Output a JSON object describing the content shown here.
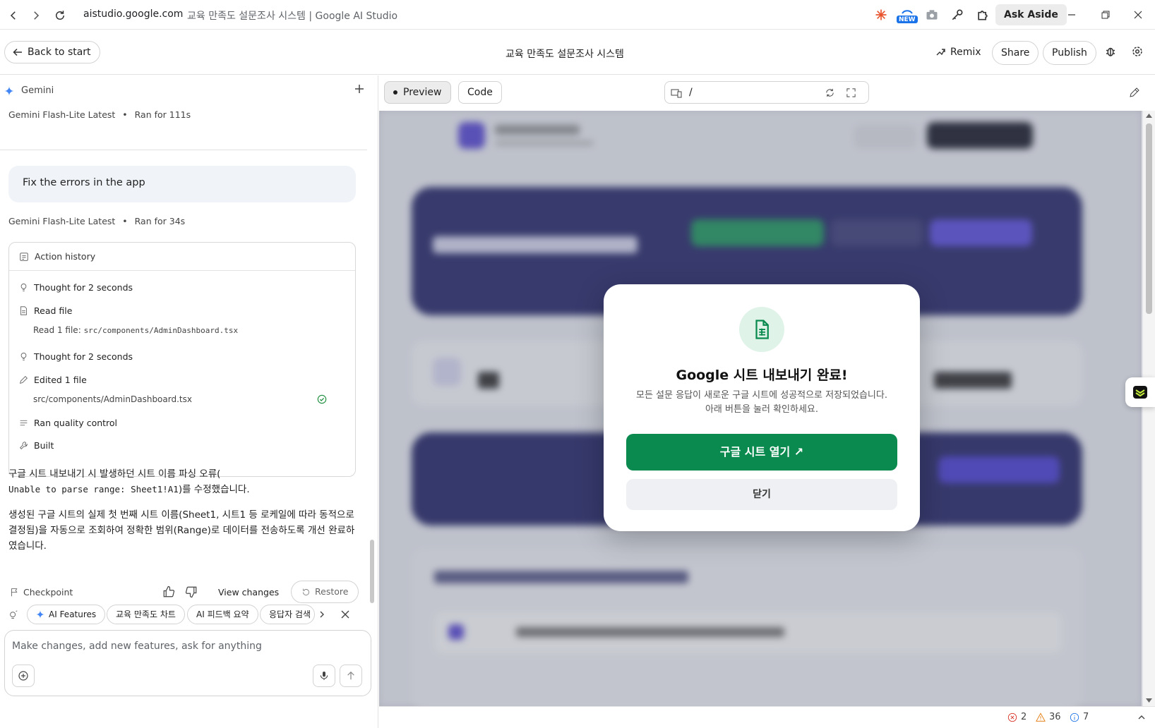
{
  "browser": {
    "url": "aistudio.google.com",
    "page_title": "교육 만족도 설문조사 시스템 | Google AI Studio",
    "new_badge": "NEW",
    "ask_aside": "Ask Aside"
  },
  "header": {
    "back_label": "Back to start",
    "title": "교육 만족도 설문조사 시스템",
    "remix": "Remix",
    "share": "Share",
    "publish": "Publish"
  },
  "chat": {
    "gemini_label": "Gemini",
    "meta1_model": "Gemini Flash-Lite Latest",
    "meta1_run": "Ran for 111s",
    "user_message": "Fix the errors in the app",
    "meta2_model": "Gemini Flash-Lite Latest",
    "meta2_run": "Ran for 34s",
    "action_history_title": "Action history",
    "actions": {
      "thought1": "Thought for 2 seconds",
      "read_file": "Read file",
      "read_sub_label": "Read 1 file:",
      "read_sub_path": "src/components/AdminDashboard.tsx",
      "thought2": "Thought for 2 seconds",
      "edited": "Edited 1 file",
      "edited_path": "src/components/AdminDashboard.tsx",
      "quality": "Ran quality control",
      "built": "Built"
    },
    "response_p1_a": "구글 시트 내보내기 시 발생하던 시트 이름 파싱 오류(",
    "response_p1_code": "Unable to parse range: Sheet1!A1",
    "response_p1_b": ")를 수정했습니다.",
    "response_p2": "생성된 구글 시트의 실제 첫 번째 시트 이름(Sheet1, 시트1 등 로케일에 따라 동적으로 결정됨)을 자동으로 조회하여 정확한 범위(Range)로 데이터를 전송하도록 개선 완료하였습니다.",
    "checkpoint": "Checkpoint",
    "view_changes": "View changes",
    "restore": "Restore",
    "chips": [
      "AI Features",
      "교육 만족도 차트",
      "AI 피드백 요약",
      "응답자 검색"
    ],
    "composer_placeholder": "Make changes, add new features, ask for anything"
  },
  "preview": {
    "tab_preview": "Preview",
    "tab_code": "Code",
    "url_path": "/",
    "modal": {
      "title": "Google 시트 내보내기 완료!",
      "desc_line1": "모든 설문 응답이 새로운 구글 시트에 성공적으로 저장되었습니다.",
      "desc_line2": "아래 버튼을 눌러 확인하세요.",
      "open_button": "구글 시트 열기 ↗",
      "close_button": "닫기"
    },
    "status": {
      "errors": "2",
      "warnings": "36",
      "info": "7"
    }
  },
  "colors": {
    "accent_green": "#0b8a4f",
    "gemini_blue": "#4285f4",
    "dashboard_navy": "#2b2a6b"
  }
}
